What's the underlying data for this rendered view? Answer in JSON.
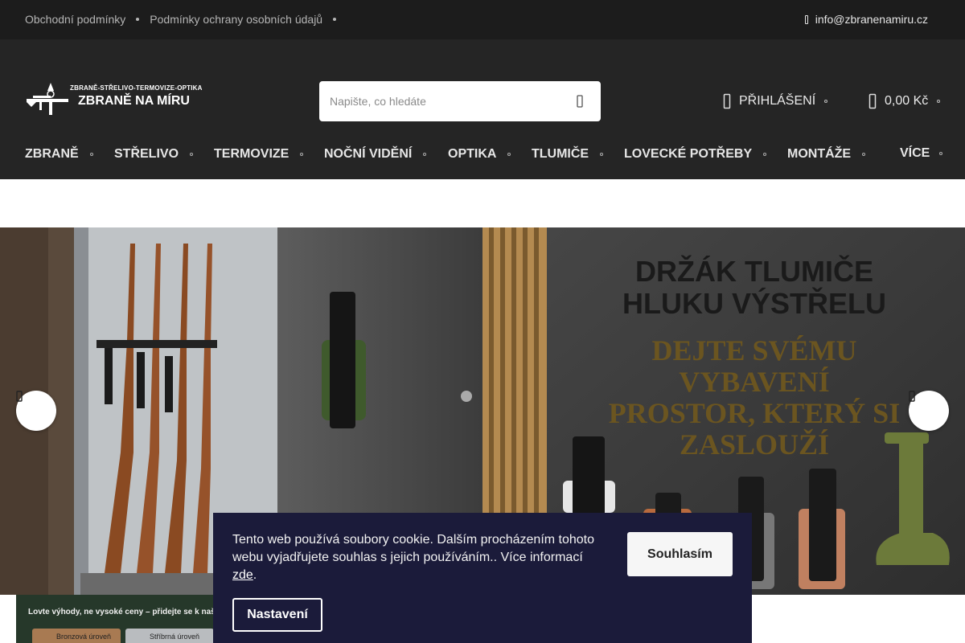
{
  "topbar": {
    "links": [
      "Obchodní podmínky",
      "Podmínky ochrany osobních údajů"
    ],
    "email": "info@zbranenamiru.cz"
  },
  "header": {
    "logo_tagline": "ZBRANĚ-STŘELIVO-TERMOVIZE-OPTIKA",
    "logo_name": "ZBRANĚ NA MÍRU",
    "search_placeholder": "Napište, co hledáte",
    "login_label": "PŘIHLÁŠENÍ",
    "cart_total": "0,00 Kč"
  },
  "nav": {
    "items": [
      "ZBRANĚ",
      "STŘELIVO",
      "TERMOVIZE",
      "NOČNÍ VIDĚNÍ",
      "OPTIKA",
      "TLUMIČE",
      "LOVECKÉ POTŘEBY",
      "MONTÁŽE",
      "VÍCE"
    ]
  },
  "hero": {
    "headline_1": "DRŽÁK TLUMIČE",
    "headline_2": "HLUKU VÝSTŘELU",
    "sub_1": "DEJTE SVÉMU",
    "sub_2": "VYBAVENÍ",
    "sub_3": "PROSTOR, KTERÝ SI",
    "sub_4": "ZASLOUŽÍ"
  },
  "promo": {
    "headline": "Lovte výhody, ne vysoké ceny – přidejte se k naš",
    "levels": [
      "Bronzová úroveň",
      "Stříbrná úroveň"
    ]
  },
  "cookie": {
    "text": "Tento web používá soubory cookie. Dalším procházením tohoto webu vyjadřujete souhlas s jejich používáním.. Více informací",
    "link": "zde",
    "accept": "Souhlasím",
    "settings": "Nastavení"
  },
  "colors": {
    "topbar_bg": "#1c1c1c",
    "header_bg": "#252525",
    "cookie_bg": "#1b1b3a",
    "hero_right_bg": "#3b3b3b",
    "hero_headline_color": "#1a1a1a",
    "hero_sub_color": "#6b5520"
  }
}
